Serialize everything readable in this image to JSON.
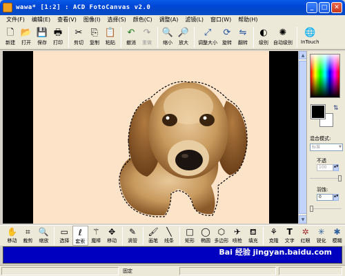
{
  "window": {
    "title": "wawa* [1:2] : ACD FotoCanvas v2.0",
    "controls": [
      "_",
      "□",
      "✕"
    ]
  },
  "menu": [
    "文件(F)",
    "编辑(E)",
    "查看(V)",
    "图像(I)",
    "选择(S)",
    "颜色(C)",
    "调整(A)",
    "滤镜(L)",
    "窗口(W)",
    "帮助(H)"
  ],
  "toolbar": [
    {
      "label": "新建",
      "icon": "new-file-icon",
      "glyph": "🗋",
      "enabled": true
    },
    {
      "label": "打开",
      "icon": "open-folder-icon",
      "glyph": "📂",
      "enabled": true
    },
    {
      "label": "保存",
      "icon": "save-disk-icon",
      "glyph": "💾",
      "enabled": true
    },
    {
      "label": "打印",
      "icon": "printer-icon",
      "glyph": "🖶",
      "enabled": true
    },
    {
      "label": "剪切",
      "icon": "cut-icon",
      "glyph": "✂",
      "enabled": true
    },
    {
      "label": "复制",
      "icon": "copy-icon",
      "glyph": "⎘",
      "enabled": true
    },
    {
      "label": "粘贴",
      "icon": "paste-icon",
      "glyph": "📋",
      "enabled": true
    },
    {
      "label": "撤消",
      "icon": "undo-icon",
      "glyph": "↶",
      "enabled": true
    },
    {
      "label": "重做",
      "icon": "redo-icon",
      "glyph": "↷",
      "enabled": false
    },
    {
      "label": "缩小",
      "icon": "zoom-out-icon",
      "glyph": "🔍",
      "enabled": true
    },
    {
      "label": "放大",
      "icon": "zoom-in-icon",
      "glyph": "🔎",
      "enabled": true
    },
    {
      "label": "调整大小",
      "icon": "resize-icon",
      "glyph": "⤢",
      "enabled": true
    },
    {
      "label": "旋转",
      "icon": "rotate-icon",
      "glyph": "⟳",
      "enabled": true
    },
    {
      "label": "翻转",
      "icon": "flip-icon",
      "glyph": "⇋",
      "enabled": true
    },
    {
      "label": "级别",
      "icon": "levels-icon",
      "glyph": "◐",
      "enabled": true
    },
    {
      "label": "自动级别",
      "icon": "auto-levels-icon",
      "glyph": "✺",
      "enabled": true
    },
    {
      "label": "InTouch",
      "icon": "intouch-globe-icon",
      "glyph": "🌐",
      "enabled": true
    }
  ],
  "panel": {
    "blend_mode_label": "混合模式:",
    "blend_mode_value": "标准",
    "opacity_label": "不透",
    "opacity_value": "100",
    "feather_label": "羽蚀:",
    "feather_value": "0",
    "colors": {
      "foreground": "#000000",
      "background": "#ffffff"
    }
  },
  "tools": [
    {
      "label": "移动",
      "icon": "hand-icon",
      "glyph": "✋"
    },
    {
      "label": "裁剪",
      "icon": "crop-icon",
      "glyph": "⌗"
    },
    {
      "label": "缩放",
      "icon": "zoom-icon",
      "glyph": "🔍"
    },
    {
      "label": "选择",
      "icon": "rect-select-icon",
      "glyph": "▭"
    },
    {
      "label": "套索",
      "icon": "lasso-icon",
      "glyph": "ℓ",
      "selected": true
    },
    {
      "label": "魔棒",
      "icon": "magic-wand-icon",
      "glyph": "⚚"
    },
    {
      "label": "移动",
      "icon": "move-arrows-icon",
      "glyph": "✥"
    },
    {
      "label": "滴管",
      "icon": "eyedropper-icon",
      "glyph": "✎"
    },
    {
      "label": "画笔",
      "icon": "brush-icon",
      "glyph": "🖌"
    },
    {
      "label": "线条",
      "icon": "line-icon",
      "glyph": "╲"
    },
    {
      "label": "矩形",
      "icon": "rectangle-icon",
      "glyph": "□"
    },
    {
      "label": "椭圆",
      "icon": "ellipse-icon",
      "glyph": "◯"
    },
    {
      "label": "多边形",
      "icon": "polygon-icon",
      "glyph": "⬡"
    },
    {
      "label": "喷枪",
      "icon": "airbrush-icon",
      "glyph": "✈"
    },
    {
      "label": "填充",
      "icon": "fill-bucket-icon",
      "glyph": "⛾"
    },
    {
      "label": "克隆",
      "icon": "clone-icon",
      "glyph": "⚘"
    },
    {
      "label": "文字",
      "icon": "text-icon",
      "glyph": "T"
    },
    {
      "label": "红眼",
      "icon": "red-eye-icon",
      "glyph": "✲"
    },
    {
      "label": "锐化",
      "icon": "sharpen-icon",
      "glyph": "✳"
    },
    {
      "label": "模糊",
      "icon": "blur-icon",
      "glyph": "✱"
    }
  ],
  "status": {
    "text": "固定"
  },
  "watermark": "Bai 经验 jingyan.baidu.com"
}
